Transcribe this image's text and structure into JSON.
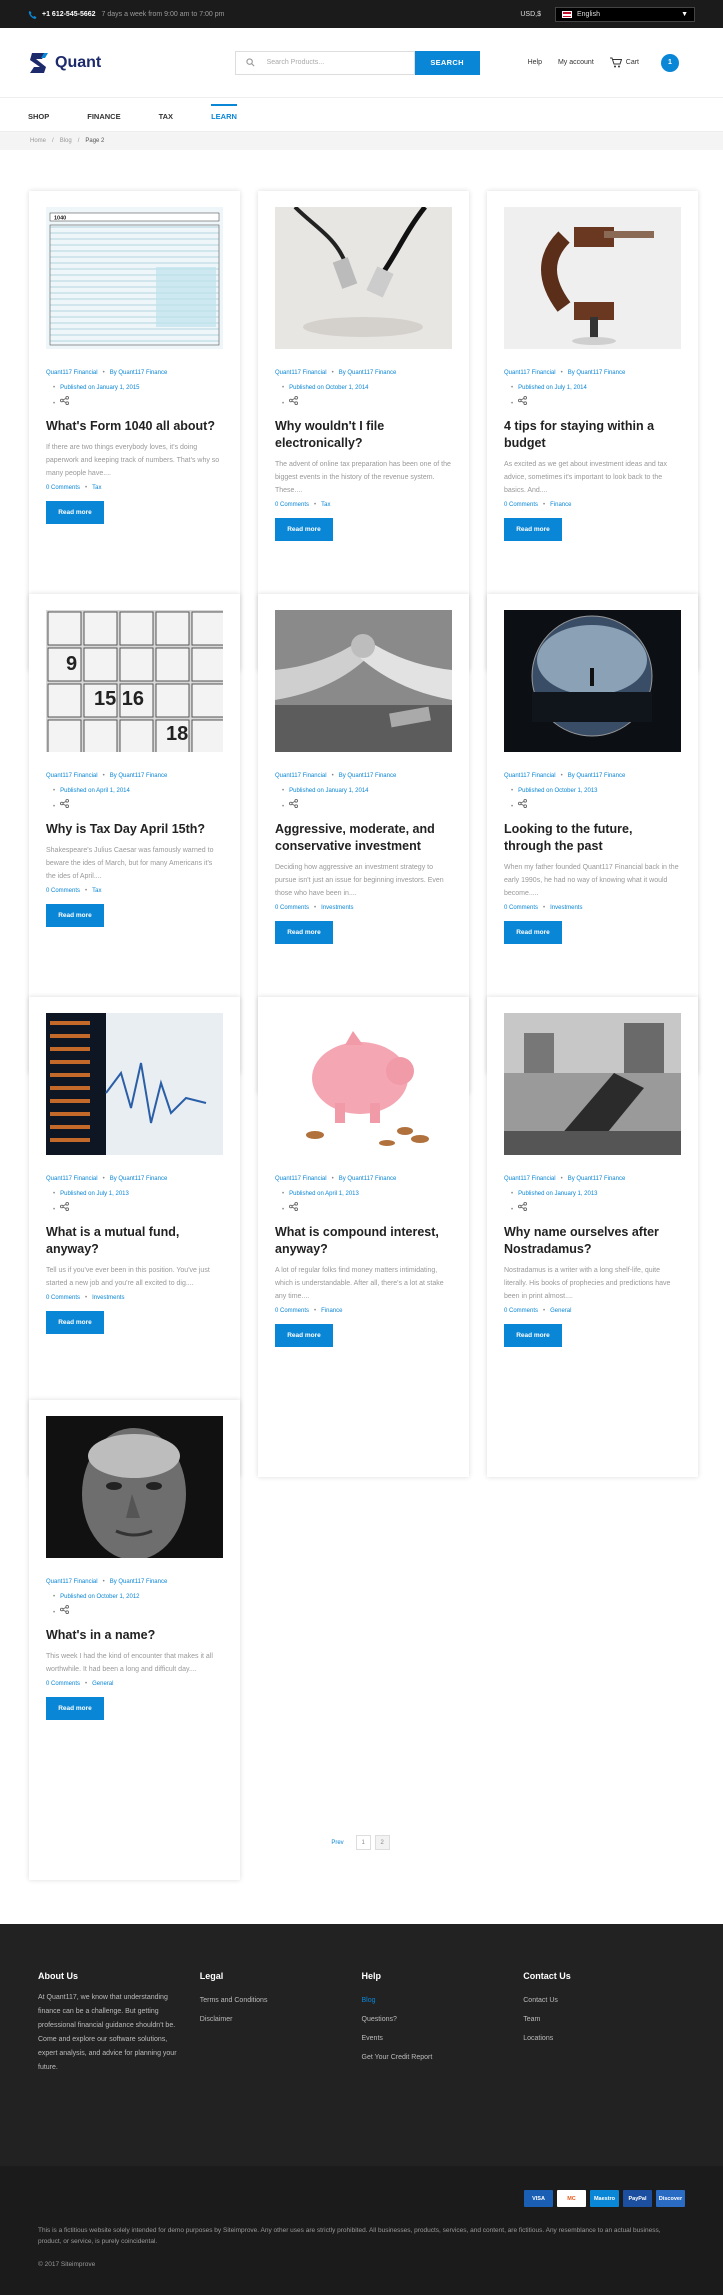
{
  "topbar": {
    "phone": "+1 612-545-5662",
    "hours": "7 days a week from 9:00 am to 7:00 pm",
    "currency": "USD,$",
    "language": "English"
  },
  "header": {
    "logo": "Quant",
    "search_placeholder": "Search Products...",
    "search_button": "SEARCH",
    "help": "Help",
    "account": "My account",
    "cart": "Cart",
    "cart_count": "1"
  },
  "nav": [
    "SHOP",
    "FINANCE",
    "TAX",
    "LEARN"
  ],
  "breadcrumb": [
    "Home",
    "Blog",
    "Page 2"
  ],
  "posts": [
    {
      "author": "Quant117 Financial",
      "by": "By Quant117 Finance",
      "published": "Published on January 1, 2015",
      "title": "What's Form 1040 all about?",
      "excerpt": "If there are two things everybody loves, it's doing paperwork and keeping track of numbers. That's why so many people have....",
      "comments": "0 Comments",
      "category": "Tax",
      "button": "Read more",
      "img": "form"
    },
    {
      "author": "Quant117 Financial",
      "by": "By Quant117 Finance",
      "published": "Published on October 1, 2014",
      "title": "Why wouldn't I file electronically?",
      "excerpt": "The advent of online tax preparation has been one of the biggest events in the history of the revenue system. These....",
      "comments": "0 Comments",
      "category": "Tax",
      "button": "Read more",
      "img": "cable"
    },
    {
      "author": "Quant117 Financial",
      "by": "By Quant117 Finance",
      "published": "Published on July 1, 2014",
      "title": "4 tips for staying within a budget",
      "excerpt": "As excited as we get about investment ideas and tax advice, sometimes it's important to look back to the basics. And....",
      "comments": "0 Comments",
      "category": "Finance",
      "button": "Read more",
      "img": "clamp"
    },
    {
      "author": "Quant117 Financial",
      "by": "By Quant117 Finance",
      "published": "Published on April 1, 2014",
      "title": "Why is Tax Day April 15th?",
      "excerpt": "Shakespeare's Julius Caesar was famously warned to beware the ides of March, but for many Americans it's the ides of April....",
      "comments": "0 Comments",
      "category": "Tax",
      "button": "Read more",
      "img": "calendar"
    },
    {
      "author": "Quant117 Financial",
      "by": "By Quant117 Finance",
      "published": "Published on January 1, 2014",
      "title": "Aggressive, moderate, and conservative investment",
      "excerpt": "Deciding how aggressive an investment strategy to pursue isn't just an issue for beginning investors. Even those who have been in....",
      "comments": "0 Comments",
      "category": "Investments",
      "button": "Read more",
      "img": "arms"
    },
    {
      "author": "Quant117 Financial",
      "by": "By Quant117 Finance",
      "published": "Published on October 1, 2013",
      "title": "Looking to the future, through the past",
      "excerpt": "When my father founded Quant117 Financial back in the early 1990s, he had no way of knowing what it would become.....",
      "comments": "0 Comments",
      "category": "Investments",
      "button": "Read more",
      "img": "sphere"
    },
    {
      "author": "Quant117 Financial",
      "by": "By Quant117 Finance",
      "published": "Published on July 1, 2013",
      "title": "What is a mutual fund, anyway?",
      "excerpt": "Tell us if you've ever been in this position. You've just started a new job and you're all excited to dig....",
      "comments": "0 Comments",
      "category": "Investments",
      "button": "Read more",
      "img": "stock"
    },
    {
      "author": "Quant117 Financial",
      "by": "By Quant117 Finance",
      "published": "Published on April 1, 2013",
      "title": "What is compound interest, anyway?",
      "excerpt": "A lot of regular folks find money matters intimidating, which is understandable. After all, there's a lot at stake any time....",
      "comments": "0 Comments",
      "category": "Finance",
      "button": "Read more",
      "img": "piggy"
    },
    {
      "author": "Quant117 Financial",
      "by": "By Quant117 Finance",
      "published": "Published on January 1, 2013",
      "title": "Why name ourselves after Nostradamus?",
      "excerpt": "Nostradamus is a writer with a long shelf-life, quite literally. His books of prophecies and predictions have been in print almost....",
      "comments": "0 Comments",
      "category": "General",
      "button": "Read more",
      "img": "train"
    },
    {
      "author": "Quant117 Financial",
      "by": "By Quant117 Finance",
      "published": "Published on October 1, 2012",
      "title": "What's in a name?",
      "excerpt": "This week I had the kind of encounter that makes it all worthwhile. It had been a long and difficult day....",
      "comments": "0 Comments",
      "category": "General",
      "button": "Read more",
      "img": "face"
    }
  ],
  "pagination": {
    "prev": "Prev",
    "pages": [
      "1",
      "2"
    ]
  },
  "footer": {
    "about_title": "About Us",
    "about_text": "At Quant117, we know that understanding finance can be a challenge. But getting professional financial guidance shouldn't be. Come and explore our software solutions, expert analysis, and advice for planning your future.",
    "legal_title": "Legal",
    "legal": [
      "Terms and Conditions",
      "Disclaimer"
    ],
    "help_title": "Help",
    "help": [
      "Blog",
      "Questions?",
      "Events",
      "Get Your Credit Report"
    ],
    "contact_title": "Contact Us",
    "contact": [
      "Contact Us",
      "Team",
      "Locations"
    ],
    "payments": [
      "VISA",
      "MC",
      "Maestro",
      "PayPal",
      "Discover"
    ],
    "disclaimer": "This is a fictitious website solely intended for demo purposes by Siteimprove. Any other uses are strictly prohibited. All businesses, products, services, and content, are fictitious. Any resemblance to an actual business, product, or service, is purely coincidental.",
    "copyright": "© 2017 Siteimprove"
  },
  "colors": {
    "accent": "#0a86d6",
    "dark": "#222222"
  }
}
